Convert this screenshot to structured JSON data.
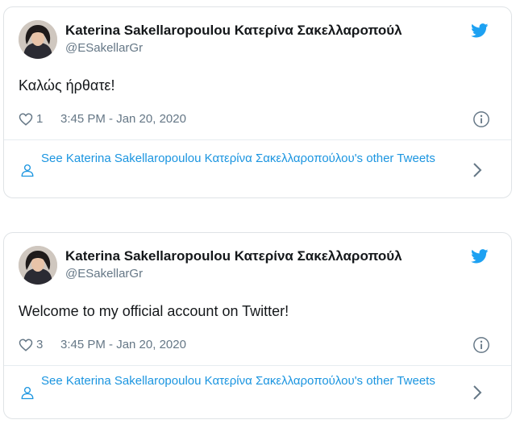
{
  "tweets": [
    {
      "author_name": "Katerina Sakellaropoulou Κατερίνα Σακελλαροπούλ",
      "handle": "@ESakellarGr",
      "text": "Καλώς ήρθατε!",
      "likes": "1",
      "timestamp": "3:45 PM - Jan 20, 2020",
      "more_link": "See Katerina Sakellaropoulou Κατερίνα Σακελλαροπούλου's other Tweets"
    },
    {
      "author_name": "Katerina Sakellaropoulou Κατερίνα Σακελλαροπούλ",
      "handle": "@ESakellarGr",
      "text": "Welcome to my official account on Twitter!",
      "likes": "3",
      "timestamp": "3:45 PM - Jan 20, 2020",
      "more_link": "See Katerina Sakellaropoulou Κατερίνα Σακελλαροπούλου's other Tweets"
    }
  ],
  "icons": {
    "brand": "twitter-bird-icon",
    "like": "heart-icon",
    "info": "info-icon",
    "profile": "person-icon",
    "chevron": "chevron-right-icon"
  },
  "colors": {
    "brand_blue": "#1da1f2",
    "link_blue": "#1b95e0",
    "muted_gray": "#657786",
    "text_dark": "#14171a"
  }
}
